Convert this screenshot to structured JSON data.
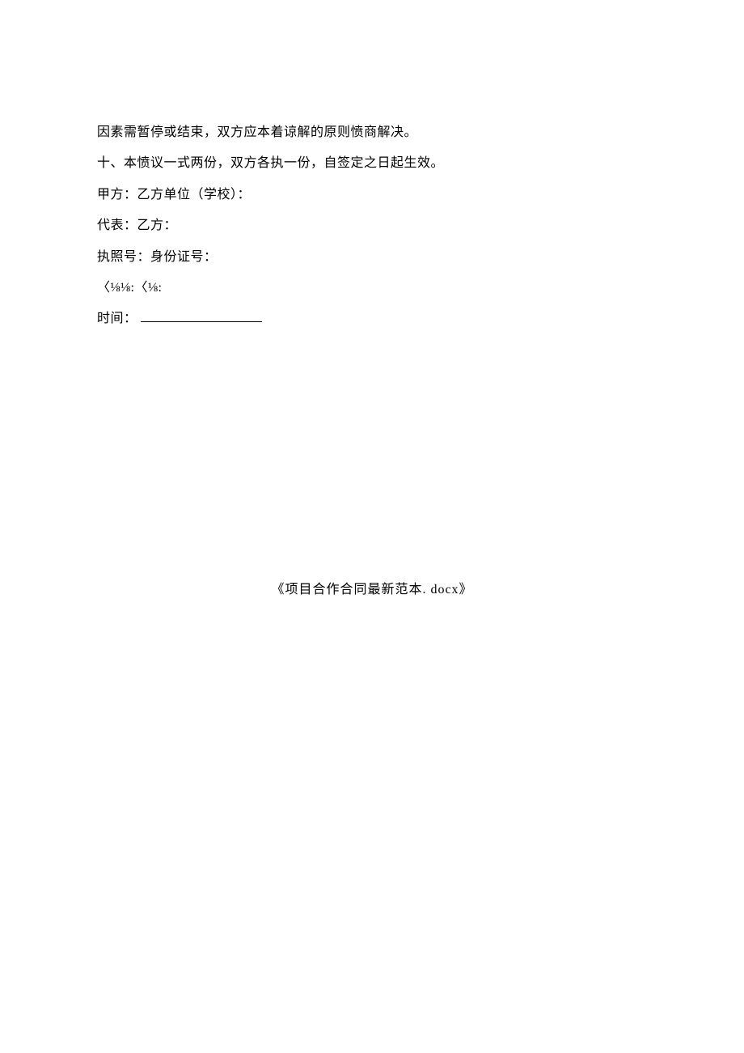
{
  "body": {
    "line1": "因素需暂停或结束，双方应本着谅解的原则愤商解决。",
    "line2": "十、本愤议一式两份，双方各执一份，自签定之日起生效。",
    "line3": "甲方：乙方单位（学校）：",
    "line4": "代表：乙方：",
    "line5": "执照号：身份证号：",
    "line6": "〈⅛⅛:〈⅛:",
    "line7_prefix": "时间："
  },
  "footer": {
    "title": "《项目合作合同最新范本. docx》"
  }
}
